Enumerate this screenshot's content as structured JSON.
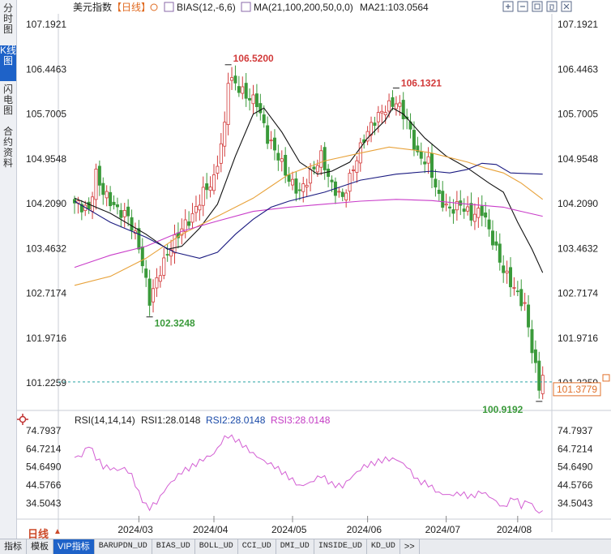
{
  "sidebar": {
    "tabs": [
      {
        "label": "分时图",
        "active": false
      },
      {
        "label": "K线图",
        "active": true
      },
      {
        "label": "闪电图",
        "active": false
      },
      {
        "label": "合约资料",
        "active": false
      }
    ]
  },
  "header": {
    "name": "美元指数",
    "period": "【日线】",
    "bias": "BIAS(12,-6,6)",
    "ma": "MA(21,100,200,50,0,0)",
    "ma21": "MA21:103.0564"
  },
  "toolbar_icons": [
    "plus-icon",
    "minus-icon",
    "expand-icon",
    "restore-icon",
    "close-icon"
  ],
  "price_axis": {
    "ticks": [
      "107.1921",
      "106.4463",
      "105.7005",
      "104.9548",
      "104.2090",
      "103.4632",
      "102.7174",
      "101.9716",
      "101.2259"
    ],
    "current_price": "101.3779"
  },
  "annotations": {
    "high_1": "106.5200",
    "high_2": "106.1321",
    "low_1": "102.3248",
    "low_2": "100.9192"
  },
  "rsi": {
    "title": "RSI(14,14,14)",
    "rsi1": "RSI1:28.0148",
    "rsi2": "RSI2:28.0148",
    "rsi3": "RSI3:28.0148",
    "ticks": [
      "74.7937",
      "64.7214",
      "54.6490",
      "44.5766",
      "34.5043"
    ]
  },
  "date_axis": [
    "2024/03",
    "2024/04",
    "2024/05",
    "2024/06",
    "2024/07",
    "2024/08"
  ],
  "period_selector": "日线",
  "bottom_tabs": [
    "指标",
    "模板",
    "VIP指标",
    "BARUPDN_UD",
    "BIAS_UD",
    "BOLL_UD",
    "CCI_UD",
    "DMI_UD",
    "INSIDE_UD",
    "KD_UD",
    ">>"
  ],
  "colors": {
    "up": "#d23a3a",
    "down": "#3a9a3a",
    "ma21": "#111111",
    "ma100": "#e8a23a",
    "ma200": "#c93cc9",
    "ma50": "#1a1a80",
    "rsi": "#d35fd3",
    "current_line": "#2aa4a4"
  },
  "chart_data": {
    "type": "candlestick",
    "series": [
      {
        "name": "MA21",
        "key": "ma21"
      },
      {
        "name": "MA100",
        "key": "ma100"
      },
      {
        "name": "MA200",
        "key": "ma200"
      },
      {
        "name": "MA50",
        "key": "ma50"
      }
    ],
    "ylim": [
      100.85,
      107.3
    ],
    "rsi_ylim": [
      27,
      78
    ],
    "key_points": [
      {
        "label": "106.5200",
        "index": 43,
        "value": 106.52
      },
      {
        "label": "106.1321",
        "index": 90,
        "value": 106.1321
      },
      {
        "label": "102.3248",
        "index": 21,
        "value": 102.3248
      },
      {
        "label": "100.9192",
        "index": 130,
        "value": 100.9192
      }
    ],
    "close_anchors": [
      [
        0,
        104.22
      ],
      [
        4,
        104.1
      ],
      [
        6,
        104.7
      ],
      [
        8,
        104.4
      ],
      [
        12,
        104.1
      ],
      [
        15,
        104.0
      ],
      [
        18,
        103.5
      ],
      [
        21,
        102.6
      ],
      [
        24,
        103.1
      ],
      [
        27,
        103.5
      ],
      [
        30,
        103.8
      ],
      [
        33,
        104.0
      ],
      [
        36,
        104.4
      ],
      [
        39,
        104.6
      ],
      [
        42,
        105.5
      ],
      [
        43,
        106.3
      ],
      [
        45,
        106.2
      ],
      [
        48,
        106.0
      ],
      [
        51,
        105.9
      ],
      [
        54,
        105.3
      ],
      [
        57,
        105.0
      ],
      [
        60,
        104.6
      ],
      [
        63,
        104.4
      ],
      [
        66,
        104.7
      ],
      [
        69,
        105.0
      ],
      [
        72,
        104.5
      ],
      [
        75,
        104.3
      ],
      [
        78,
        104.8
      ],
      [
        81,
        105.3
      ],
      [
        84,
        105.6
      ],
      [
        87,
        105.8
      ],
      [
        90,
        105.9
      ],
      [
        93,
        105.6
      ],
      [
        96,
        105.0
      ],
      [
        99,
        104.9
      ],
      [
        102,
        104.3
      ],
      [
        105,
        104.1
      ],
      [
        108,
        104.2
      ],
      [
        111,
        104.0
      ],
      [
        114,
        104.1
      ],
      [
        117,
        103.6
      ],
      [
        120,
        103.1
      ],
      [
        123,
        102.8
      ],
      [
        126,
        102.5
      ],
      [
        128,
        101.8
      ],
      [
        130,
        101.15
      ],
      [
        131,
        101.38
      ]
    ],
    "ma21": [
      [
        0,
        104.3
      ],
      [
        10,
        104.05
      ],
      [
        20,
        103.7
      ],
      [
        26,
        103.45
      ],
      [
        30,
        103.5
      ],
      [
        35,
        103.8
      ],
      [
        40,
        104.2
      ],
      [
        45,
        105.0
      ],
      [
        50,
        105.7
      ],
      [
        53,
        105.8
      ],
      [
        58,
        105.4
      ],
      [
        63,
        104.9
      ],
      [
        68,
        104.7
      ],
      [
        72,
        104.75
      ],
      [
        77,
        104.9
      ],
      [
        82,
        105.3
      ],
      [
        87,
        105.6
      ],
      [
        89,
        105.8
      ],
      [
        92,
        105.7
      ],
      [
        98,
        105.3
      ],
      [
        104,
        105.0
      ],
      [
        110,
        104.8
      ],
      [
        116,
        104.55
      ],
      [
        120,
        104.4
      ],
      [
        124,
        103.9
      ],
      [
        128,
        103.45
      ],
      [
        131,
        103.06
      ]
    ],
    "ma100": [
      [
        0,
        102.85
      ],
      [
        10,
        103.0
      ],
      [
        20,
        103.3
      ],
      [
        30,
        103.7
      ],
      [
        40,
        104.0
      ],
      [
        50,
        104.3
      ],
      [
        55,
        104.5
      ],
      [
        60,
        104.7
      ],
      [
        70,
        104.92
      ],
      [
        80,
        105.05
      ],
      [
        88,
        105.15
      ],
      [
        95,
        105.1
      ],
      [
        100,
        105.05
      ],
      [
        110,
        104.9
      ],
      [
        115,
        104.8
      ],
      [
        120,
        104.72
      ],
      [
        125,
        104.55
      ],
      [
        131,
        104.28
      ]
    ],
    "ma200": [
      [
        0,
        103.15
      ],
      [
        10,
        103.35
      ],
      [
        20,
        103.5
      ],
      [
        30,
        103.75
      ],
      [
        40,
        103.92
      ],
      [
        50,
        104.08
      ],
      [
        60,
        104.15
      ],
      [
        70,
        104.2
      ],
      [
        80,
        104.25
      ],
      [
        90,
        104.28
      ],
      [
        100,
        104.26
      ],
      [
        110,
        104.2
      ],
      [
        120,
        104.15
      ],
      [
        125,
        104.08
      ],
      [
        131,
        104.0
      ]
    ],
    "ma50": [
      [
        0,
        104.25
      ],
      [
        10,
        103.9
      ],
      [
        20,
        103.65
      ],
      [
        28,
        103.4
      ],
      [
        35,
        103.3
      ],
      [
        40,
        103.4
      ],
      [
        45,
        103.7
      ],
      [
        50,
        103.95
      ],
      [
        55,
        104.15
      ],
      [
        60,
        104.25
      ],
      [
        70,
        104.4
      ],
      [
        80,
        104.6
      ],
      [
        90,
        104.7
      ],
      [
        100,
        104.75
      ],
      [
        105,
        104.72
      ],
      [
        110,
        104.78
      ],
      [
        114,
        104.88
      ],
      [
        118,
        104.86
      ],
      [
        122,
        104.72
      ],
      [
        131,
        104.7
      ]
    ],
    "rsi_anchors": [
      [
        0,
        60
      ],
      [
        2,
        61
      ],
      [
        4,
        67
      ],
      [
        6,
        60
      ],
      [
        8,
        55
      ],
      [
        10,
        54
      ],
      [
        12,
        53
      ],
      [
        14,
        54
      ],
      [
        16,
        50
      ],
      [
        18,
        40
      ],
      [
        20,
        33
      ],
      [
        21,
        32
      ],
      [
        23,
        35
      ],
      [
        26,
        44
      ],
      [
        30,
        52
      ],
      [
        33,
        55
      ],
      [
        36,
        59
      ],
      [
        39,
        62
      ],
      [
        42,
        71
      ],
      [
        43,
        72
      ],
      [
        45,
        70
      ],
      [
        47,
        67
      ],
      [
        50,
        62
      ],
      [
        53,
        58
      ],
      [
        56,
        55
      ],
      [
        60,
        49
      ],
      [
        63,
        44
      ],
      [
        66,
        46
      ],
      [
        69,
        50
      ],
      [
        72,
        45
      ],
      [
        75,
        44
      ],
      [
        78,
        50
      ],
      [
        81,
        55
      ],
      [
        84,
        57
      ],
      [
        87,
        59
      ],
      [
        90,
        59
      ],
      [
        93,
        55
      ],
      [
        96,
        47
      ],
      [
        99,
        45
      ],
      [
        102,
        40
      ],
      [
        105,
        39
      ],
      [
        108,
        40
      ],
      [
        111,
        38
      ],
      [
        114,
        41
      ],
      [
        117,
        37
      ],
      [
        120,
        32
      ],
      [
        123,
        38
      ],
      [
        125,
        33
      ],
      [
        127,
        36
      ],
      [
        129,
        31
      ],
      [
        130,
        29
      ],
      [
        131,
        30
      ]
    ]
  }
}
